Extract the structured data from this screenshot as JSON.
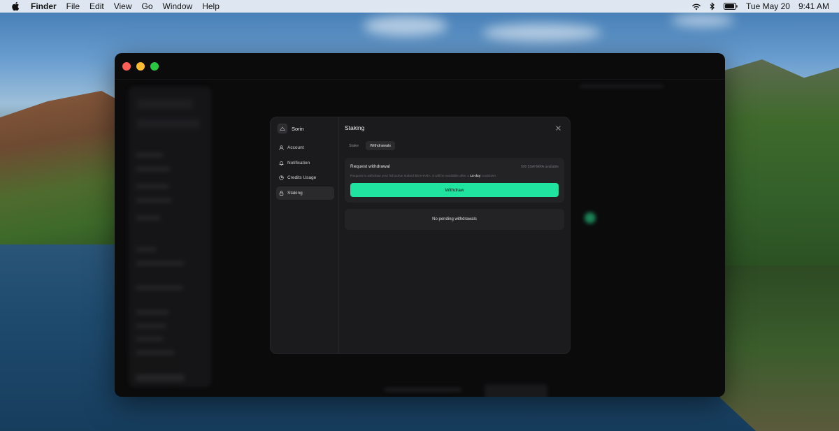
{
  "menubar": {
    "app_name": "Finder",
    "menus": [
      "File",
      "Edit",
      "View",
      "Go",
      "Window",
      "Help"
    ],
    "date": "Tue May 20",
    "time": "9:41 AM"
  },
  "settings_modal": {
    "profile_name": "Sorin",
    "nav_items": [
      {
        "label": "Account",
        "icon": "user-icon"
      },
      {
        "label": "Notification",
        "icon": "bell-icon"
      },
      {
        "label": "Credits Usage",
        "icon": "pie-chart-icon"
      },
      {
        "label": "Staking",
        "icon": "lock-icon",
        "active": true
      }
    ],
    "title": "Staking",
    "tabs": [
      {
        "label": "Stake",
        "active": false
      },
      {
        "label": "Withdrawals",
        "active": true
      }
    ],
    "withdraw_card": {
      "title": "Request withdrawal",
      "available": "500 $SAHARA available",
      "description_prefix": "Request to withdraw your full active staked $SAHARA. It will be available after a",
      "description_highlight": "14-day",
      "description_suffix": "cooldown.",
      "button_label": "Withdraw"
    },
    "pending_message": "No pending withdrawals"
  },
  "colors": {
    "accent": "#21e3a0",
    "modal_bg": "#1b1b1d",
    "window_bg": "#0b0b0c"
  }
}
